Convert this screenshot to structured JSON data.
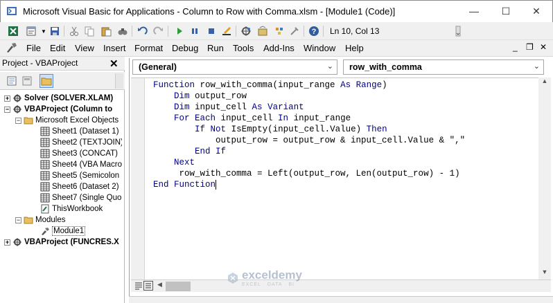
{
  "window": {
    "title": "Microsoft Visual Basic for Applications - Column to Row with Comma.xlsm - [Module1 (Code)]",
    "minimize": "—",
    "maximize": "☐",
    "close": "✕"
  },
  "toolbar": {
    "position": "Ln 10, Col 13",
    "icons": [
      "excel-icon",
      "insert-module-icon",
      "save-icon",
      "cut-icon",
      "copy-icon",
      "paste-icon",
      "find-icon",
      "undo-icon",
      "redo-icon",
      "run-icon",
      "break-icon",
      "reset-icon",
      "design-mode-icon",
      "project-explorer-icon",
      "properties-icon",
      "object-browser-icon",
      "toolbox-icon",
      "help-icon"
    ]
  },
  "menu": {
    "items": [
      "File",
      "Edit",
      "View",
      "Insert",
      "Format",
      "Debug",
      "Run",
      "Tools",
      "Add-Ins",
      "Window",
      "Help"
    ],
    "mdi_minimize": "_",
    "mdi_restore": "❐",
    "mdi_close": "✕"
  },
  "project": {
    "title": "Project - VBAProject",
    "close": "✕",
    "tree": [
      {
        "label": "Solver (SOLVER.XLAM)",
        "level": 0,
        "bold": true,
        "expander": "+"
      },
      {
        "label": "VBAProject (Column to",
        "level": 0,
        "bold": true,
        "expander": "−"
      },
      {
        "label": "Microsoft Excel Objects",
        "level": 1,
        "bold": false,
        "expander": "−"
      },
      {
        "label": "Sheet1 (Dataset 1)",
        "level": 2,
        "bold": false,
        "expander": ""
      },
      {
        "label": "Sheet2 (TEXTJOIN)",
        "level": 2,
        "bold": false,
        "expander": ""
      },
      {
        "label": "Sheet3 (CONCAT)",
        "level": 2,
        "bold": false,
        "expander": ""
      },
      {
        "label": "Sheet4 (VBA Macro",
        "level": 2,
        "bold": false,
        "expander": ""
      },
      {
        "label": "Sheet5 (Semicolon",
        "level": 2,
        "bold": false,
        "expander": ""
      },
      {
        "label": "Sheet6 (Dataset 2)",
        "level": 2,
        "bold": false,
        "expander": ""
      },
      {
        "label": "Sheet7 (Single Quo",
        "level": 2,
        "bold": false,
        "expander": ""
      },
      {
        "label": "ThisWorkbook",
        "level": 2,
        "bold": false,
        "expander": ""
      },
      {
        "label": "Modules",
        "level": 1,
        "bold": false,
        "expander": "−"
      },
      {
        "label": "Module1",
        "level": 2,
        "bold": false,
        "expander": ""
      },
      {
        "label": "VBAProject (FUNCRES.X",
        "level": 0,
        "bold": true,
        "expander": "+"
      }
    ]
  },
  "editor": {
    "object_combo": "(General)",
    "procedure_combo": "row_with_comma",
    "code_lines": [
      "Function row_with_comma(input_range As Range)",
      "    Dim output_row",
      "    Dim input_cell As Variant",
      "    For Each input_cell In input_range",
      "        If Not IsEmpty(input_cell.Value) Then",
      "            output_row = output_row & input_cell.Value & \",\"",
      "        End If",
      "    Next",
      "     row_with_comma = Left(output_row, Len(output_row) - 1)",
      "End Function"
    ]
  },
  "watermark": {
    "name": "exceldemy",
    "tagline": "EXCEL · DATA · BI"
  }
}
